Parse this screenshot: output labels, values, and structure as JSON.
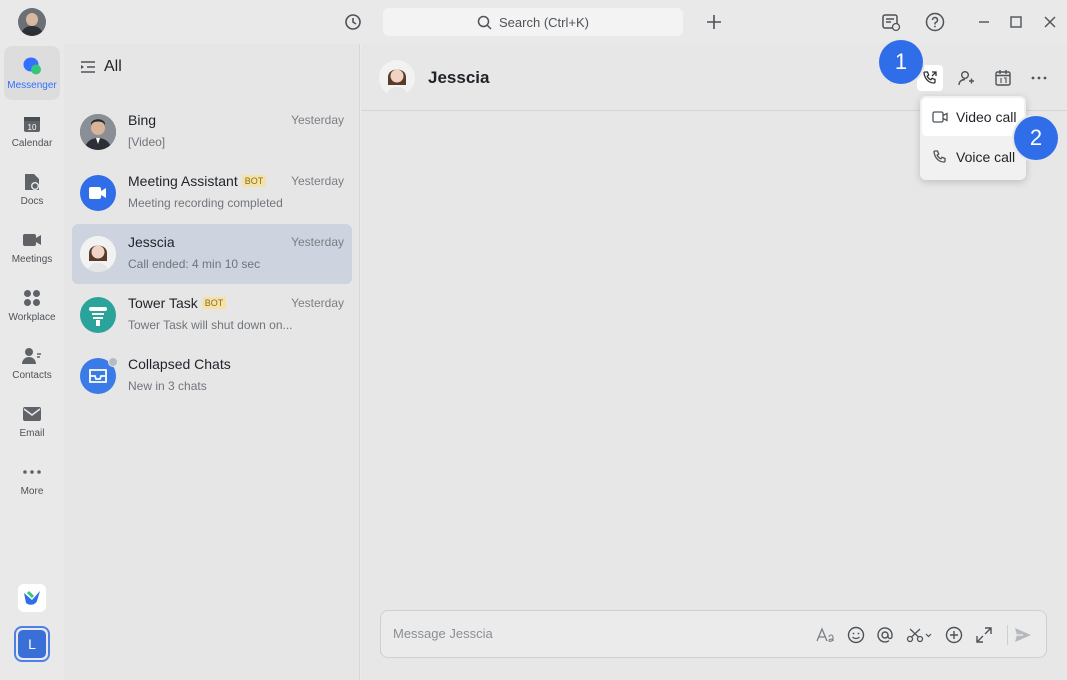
{
  "topbar": {
    "search_placeholder": "Search (Ctrl+K)"
  },
  "nav": {
    "items": [
      {
        "label": "Messenger",
        "icon": "messenger-icon",
        "active": true
      },
      {
        "label": "Calendar",
        "icon": "calendar-icon",
        "day": "10"
      },
      {
        "label": "Docs",
        "icon": "docs-icon"
      },
      {
        "label": "Meetings",
        "icon": "video-camera-icon"
      },
      {
        "label": "Workplace",
        "icon": "apps-grid-icon"
      },
      {
        "label": "Contacts",
        "icon": "contacts-icon"
      },
      {
        "label": "Email",
        "icon": "envelope-icon"
      },
      {
        "label": "More",
        "icon": "ellipsis-icon"
      }
    ],
    "user_initial": "L"
  },
  "chat_list": {
    "filter_label": "All",
    "chats": [
      {
        "name": "Bing",
        "time": "Yesterday",
        "preview": "[Video]",
        "bot": false
      },
      {
        "name": "Meeting Assistant",
        "time": "Yesterday",
        "preview": "Meeting recording completed",
        "bot": true,
        "bot_label": "BOT"
      },
      {
        "name": "Jesscia",
        "time": "Yesterday",
        "preview": "Call ended: 4 min 10 sec",
        "bot": false,
        "selected": true
      },
      {
        "name": "Tower Task",
        "time": "Yesterday",
        "preview": "Tower Task will shut down on...",
        "bot": true,
        "bot_label": "BOT"
      },
      {
        "name": "Collapsed Chats",
        "time": "",
        "preview": "New in 3 chats",
        "bot": false
      }
    ]
  },
  "conversation": {
    "title": "Jesscia",
    "call_menu": {
      "video_call": "Video call",
      "voice_call": "Voice call"
    },
    "markers": [
      "1",
      "2"
    ],
    "composer_placeholder": "Message Jesscia"
  },
  "colors": {
    "accent": "#3370ff",
    "marker": "#2f6ee8",
    "selected_row": "#cdd4df",
    "bot_tag_bg": "#f4e2a8"
  }
}
